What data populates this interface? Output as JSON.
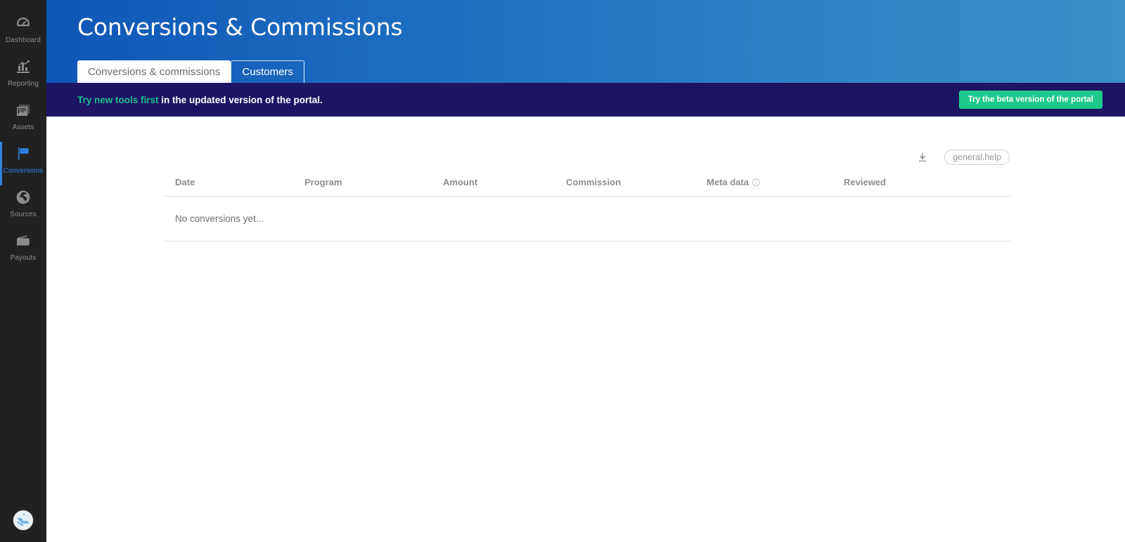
{
  "sidebar": {
    "items": [
      {
        "label": "Dashboard",
        "icon": "gauge-icon",
        "active": false
      },
      {
        "label": "Reporting",
        "icon": "bar-chart-icon",
        "active": false
      },
      {
        "label": "Assets",
        "icon": "image-icon",
        "active": false
      },
      {
        "label": "Conversions",
        "icon": "flag-icon",
        "active": true
      },
      {
        "label": "Sources",
        "icon": "globe-icon",
        "active": false
      },
      {
        "label": "Payouts",
        "icon": "wallet-icon",
        "active": false
      }
    ],
    "avatar": {
      "icon": "globe-avatar"
    }
  },
  "header": {
    "title": "Conversions & Commissions",
    "tabs": [
      {
        "label": "Conversions & commissions",
        "active": true
      },
      {
        "label": "Customers",
        "active": false
      }
    ]
  },
  "banner": {
    "highlight": "Try new tools first",
    "rest": " in the updated version of the portal.",
    "button_label": "Try the beta version of the portal"
  },
  "toolbar": {
    "download_icon": "download-icon",
    "help_badge": "general.help"
  },
  "table": {
    "columns": [
      {
        "label": "Date"
      },
      {
        "label": "Program"
      },
      {
        "label": "Amount"
      },
      {
        "label": "Commission"
      },
      {
        "label": "Meta data",
        "info": true
      }
    ],
    "last_column": {
      "label": "Reviewed"
    },
    "empty_message": "No conversions yet..."
  },
  "colors": {
    "sidebar_bg": "#212121",
    "header_gradient_start": "#0f57b8",
    "header_gradient_end": "#3b90c9",
    "banner_bg": "#1d1464",
    "accent_green": "#1ec98c",
    "active_blue": "#2f80e0"
  }
}
